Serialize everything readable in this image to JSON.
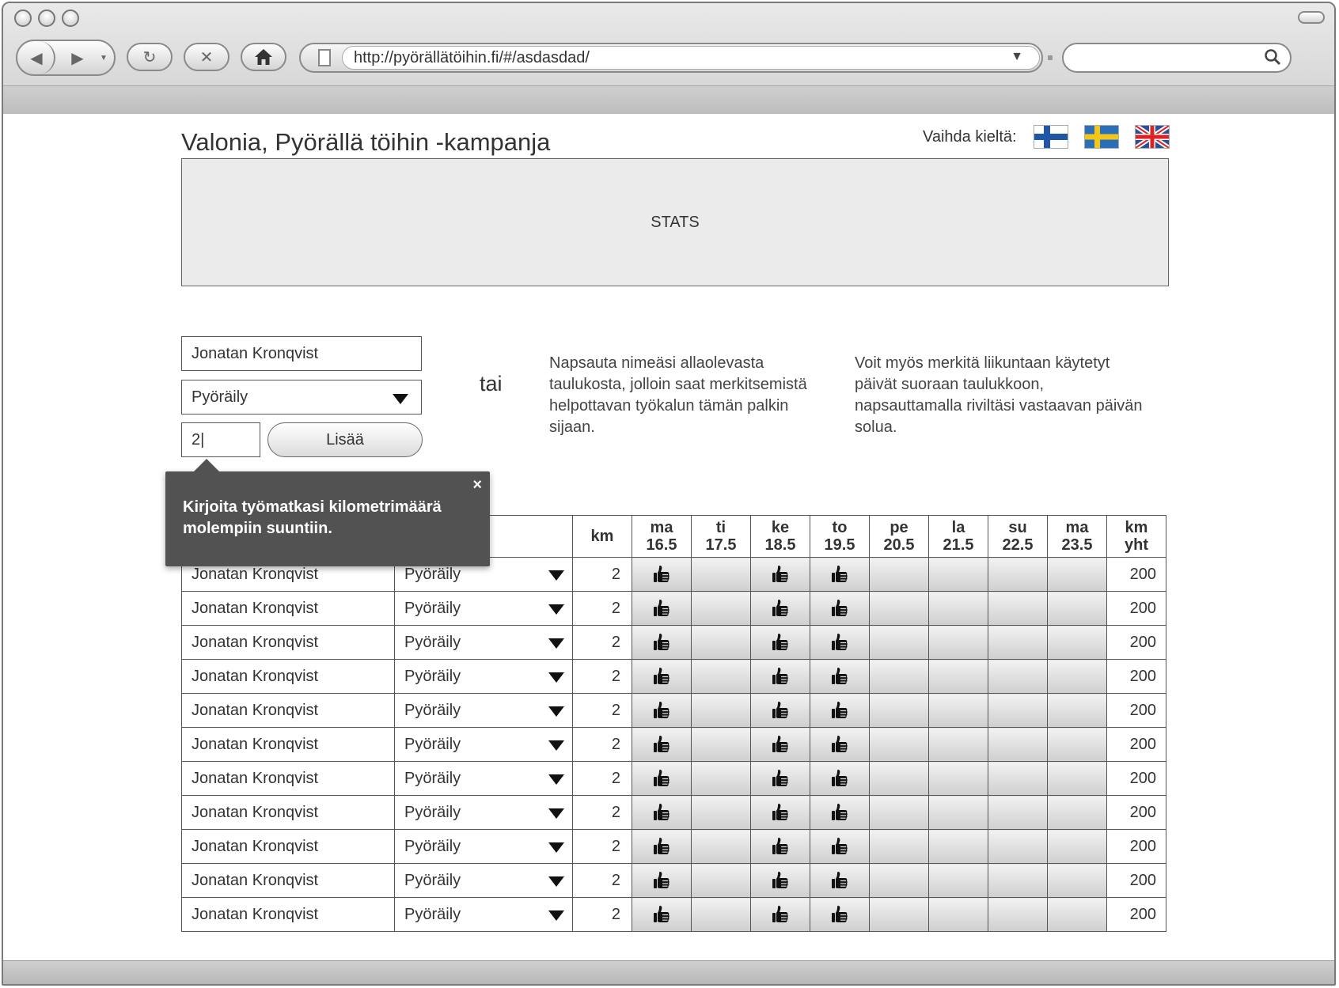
{
  "browser": {
    "url": "http://pyörällätöihin.fi/#/asdasdad/",
    "search_value": ""
  },
  "page": {
    "title": "Valonia, Pyörällä töihin -kampanja",
    "language_label": "Vaihda kieltä:",
    "stats_placeholder": "STATS"
  },
  "form": {
    "name_value": "Jonatan Kronqvist",
    "transport_value": "Pyöräily",
    "km_value": "2|",
    "add_label": "Lisää",
    "or_label": "tai",
    "instruction_click_name": "Napsauta nimeäsi allaolevasta taulukosta, jolloin saat merkitsemistä helpottavan työkalun tämän palkin sijaan.",
    "instruction_click_cells": "Voit myös merkitä liikuntaan käytetyt päivät suoraan taulukkoon, napsauttamalla riviltäsi vastaavan päivän solua."
  },
  "tooltip": {
    "message": "Kirjoita työmatkasi kilometrimäärä molempiin suuntiin.",
    "close": "×"
  },
  "table": {
    "km_header": "km",
    "total_header": [
      "km",
      "yht"
    ],
    "days": [
      {
        "day": "ma",
        "date": "16.5"
      },
      {
        "day": "ti",
        "date": "17.5"
      },
      {
        "day": "ke",
        "date": "18.5"
      },
      {
        "day": "to",
        "date": "19.5"
      },
      {
        "day": "pe",
        "date": "20.5"
      },
      {
        "day": "la",
        "date": "21.5"
      },
      {
        "day": "su",
        "date": "22.5"
      },
      {
        "day": "ma",
        "date": "23.5"
      }
    ],
    "rows": [
      {
        "name": "Jonatan Kronqvist",
        "mode": "Pyöräily",
        "km": "2",
        "marked": [
          true,
          false,
          true,
          true,
          false,
          false,
          false,
          false
        ],
        "total": "200"
      },
      {
        "name": "Jonatan Kronqvist",
        "mode": "Pyöräily",
        "km": "2",
        "marked": [
          true,
          false,
          true,
          true,
          false,
          false,
          false,
          false
        ],
        "total": "200"
      },
      {
        "name": "Jonatan Kronqvist",
        "mode": "Pyöräily",
        "km": "2",
        "marked": [
          true,
          false,
          true,
          true,
          false,
          false,
          false,
          false
        ],
        "total": "200"
      },
      {
        "name": "Jonatan Kronqvist",
        "mode": "Pyöräily",
        "km": "2",
        "marked": [
          true,
          false,
          true,
          true,
          false,
          false,
          false,
          false
        ],
        "total": "200"
      },
      {
        "name": "Jonatan Kronqvist",
        "mode": "Pyöräily",
        "km": "2",
        "marked": [
          true,
          false,
          true,
          true,
          false,
          false,
          false,
          false
        ],
        "total": "200"
      },
      {
        "name": "Jonatan Kronqvist",
        "mode": "Pyöräily",
        "km": "2",
        "marked": [
          true,
          false,
          true,
          true,
          false,
          false,
          false,
          false
        ],
        "total": "200"
      },
      {
        "name": "Jonatan Kronqvist",
        "mode": "Pyöräily",
        "km": "2",
        "marked": [
          true,
          false,
          true,
          true,
          false,
          false,
          false,
          false
        ],
        "total": "200"
      },
      {
        "name": "Jonatan Kronqvist",
        "mode": "Pyöräily",
        "km": "2",
        "marked": [
          true,
          false,
          true,
          true,
          false,
          false,
          false,
          false
        ],
        "total": "200"
      },
      {
        "name": "Jonatan Kronqvist",
        "mode": "Pyöräily",
        "km": "2",
        "marked": [
          true,
          false,
          true,
          true,
          false,
          false,
          false,
          false
        ],
        "total": "200"
      },
      {
        "name": "Jonatan Kronqvist",
        "mode": "Pyöräily",
        "km": "2",
        "marked": [
          true,
          false,
          true,
          true,
          false,
          false,
          false,
          false
        ],
        "total": "200"
      },
      {
        "name": "Jonatan Kronqvist",
        "mode": "Pyöräily",
        "km": "2",
        "marked": [
          true,
          false,
          true,
          true,
          false,
          false,
          false,
          false
        ],
        "total": "200"
      }
    ]
  },
  "icons": {
    "marked_day": "thumbs-up-icon",
    "languages": [
      "flag-finland-icon",
      "flag-sweden-icon",
      "flag-uk-icon"
    ]
  }
}
